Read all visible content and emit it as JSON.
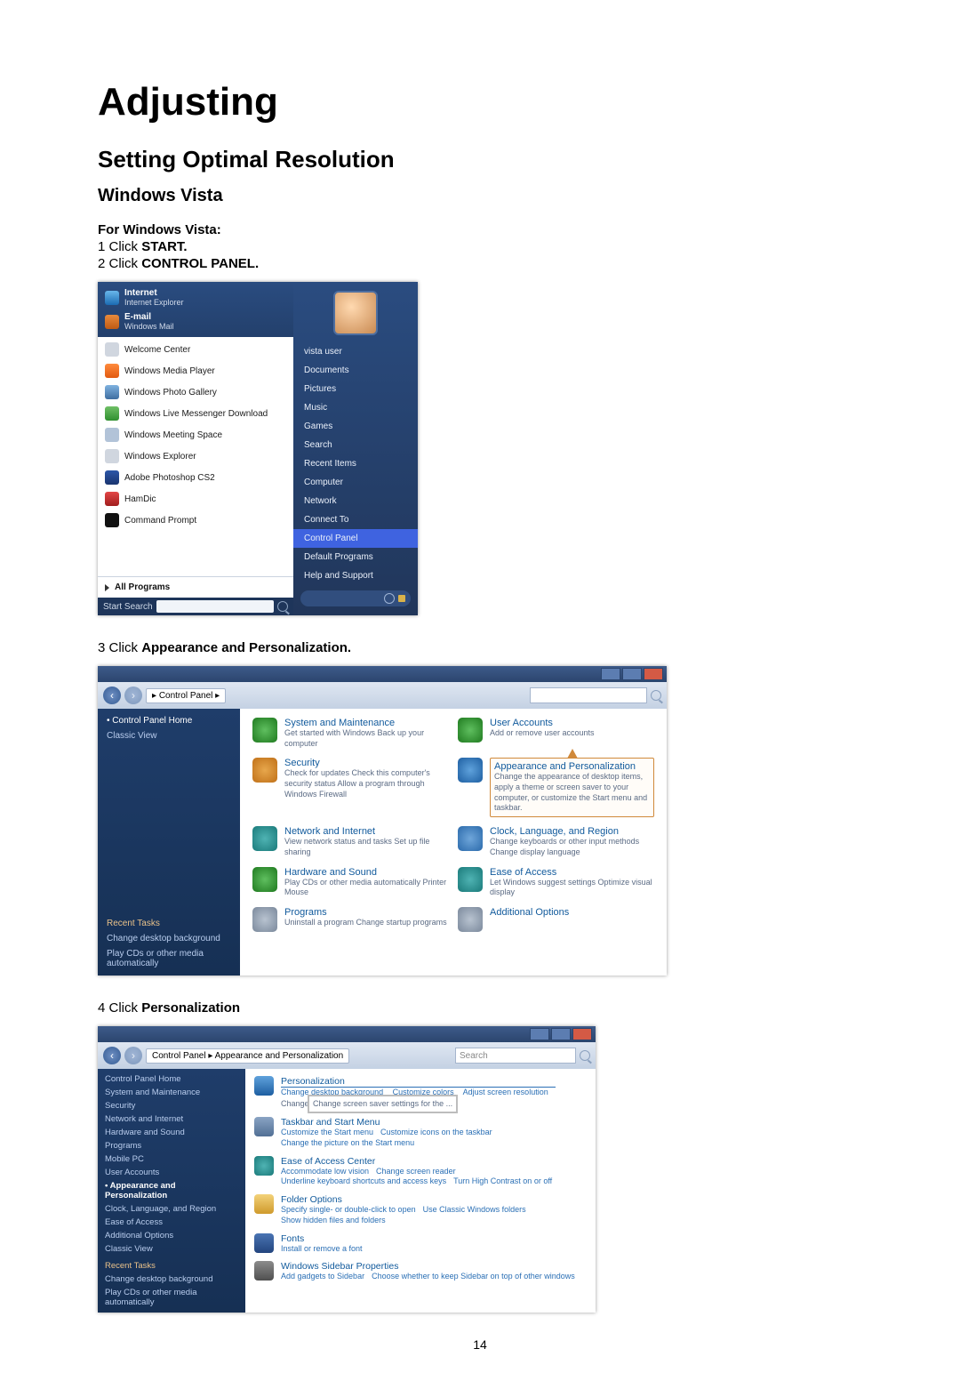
{
  "doc": {
    "title": "Adjusting",
    "section": "Setting Optimal Resolution",
    "subsection": "Windows Vista",
    "intro": "For Windows Vista:",
    "step1_pre": "1 Click ",
    "step1_bold": "START.",
    "step2_pre": "2 Click ",
    "step2_bold": "CONTROL PANEL.",
    "step3_pre": "3 Click ",
    "step3_bold": "Appearance and Personalization.",
    "step4_pre": "4 Click ",
    "step4_bold": "Personalization",
    "page_number": "14"
  },
  "startmenu": {
    "pinned": [
      {
        "title": "Internet",
        "sub": "Internet Explorer"
      },
      {
        "title": "E-mail",
        "sub": "Windows Mail"
      }
    ],
    "apps": [
      "Welcome Center",
      "Windows Media Player",
      "Windows Photo Gallery",
      "Windows Live Messenger Download",
      "Windows Meeting Space",
      "Windows Explorer",
      "Adobe Photoshop CS2",
      "HamDic",
      "Command Prompt"
    ],
    "all_programs": "All Programs",
    "search_placeholder": "Start Search",
    "right": [
      "vista user",
      "Documents",
      "Pictures",
      "Music",
      "Games",
      "Search",
      "Recent Items",
      "Computer",
      "Network",
      "Connect To",
      "Control Panel",
      "Default Programs",
      "Help and Support"
    ],
    "selected_right": "Control Panel"
  },
  "cp": {
    "breadcrumb": "Control Panel",
    "side_header": "Control Panel Home",
    "side_link": "Classic View",
    "recent_header": "Recent Tasks",
    "recent": [
      "Change desktop background",
      "Play CDs or other media automatically"
    ],
    "cats": [
      {
        "t": "System and Maintenance",
        "s": "Get started with Windows\nBack up your computer"
      },
      {
        "t": "User Accounts",
        "s": "Add or remove user accounts"
      },
      {
        "t": "Security",
        "s": "Check for updates\nCheck this computer's security status\nAllow a program through Windows Firewall"
      },
      {
        "t": "Appearance and Personalization",
        "s": "Change the appearance of desktop items, apply a theme or screen saver to your computer, or customize the Start menu and taskbar."
      },
      {
        "t": "Network and Internet",
        "s": "View network status and tasks\nSet up file sharing"
      },
      {
        "t": "Clock, Language, and Region",
        "s": "Change keyboards or other input methods\nChange display language"
      },
      {
        "t": "Hardware and Sound",
        "s": "Play CDs or other media automatically\nPrinter\nMouse"
      },
      {
        "t": "Ease of Access",
        "s": "Let Windows suggest settings\nOptimize visual display"
      },
      {
        "t": "Programs",
        "s": "Uninstall a program\nChange startup programs"
      },
      {
        "t": "Additional Options",
        "s": ""
      }
    ]
  },
  "ap": {
    "breadcrumb": "Control Panel ▸ Appearance and Personalization",
    "search_placeholder": "Search",
    "side": [
      "Control Panel Home",
      "System and Maintenance",
      "Security",
      "Network and Internet",
      "Hardware and Sound",
      "Programs",
      "Mobile PC",
      "User Accounts",
      "Appearance and Personalization",
      "Clock, Language, and Region",
      "Ease of Access",
      "Additional Options",
      "Classic View"
    ],
    "side_selected": "Appearance and Personalization",
    "recent_header": "Recent Tasks",
    "recent": [
      "Change desktop background",
      "Play CDs or other media automatically"
    ],
    "rows": [
      {
        "t": "Personalization",
        "s": [
          "Change desktop background",
          "Customize colors",
          "Adjust screen resolution"
        ],
        "extra": "Change screen saver settings for the ..."
      },
      {
        "t": "Taskbar and Start Menu",
        "s": [
          "Customize the Start menu",
          "Customize icons on the taskbar",
          "Change the picture on the Start menu"
        ]
      },
      {
        "t": "Ease of Access Center",
        "s": [
          "Accommodate low vision",
          "Change screen reader",
          "Underline keyboard shortcuts and access keys",
          "Turn High Contrast on or off"
        ]
      },
      {
        "t": "Folder Options",
        "s": [
          "Specify single- or double-click to open",
          "Use Classic Windows folders",
          "Show hidden files and folders"
        ]
      },
      {
        "t": "Fonts",
        "s": [
          "Install or remove a font"
        ]
      },
      {
        "t": "Windows Sidebar Properties",
        "s": [
          "Add gadgets to Sidebar",
          "Choose whether to keep Sidebar on top of other windows"
        ]
      }
    ]
  }
}
